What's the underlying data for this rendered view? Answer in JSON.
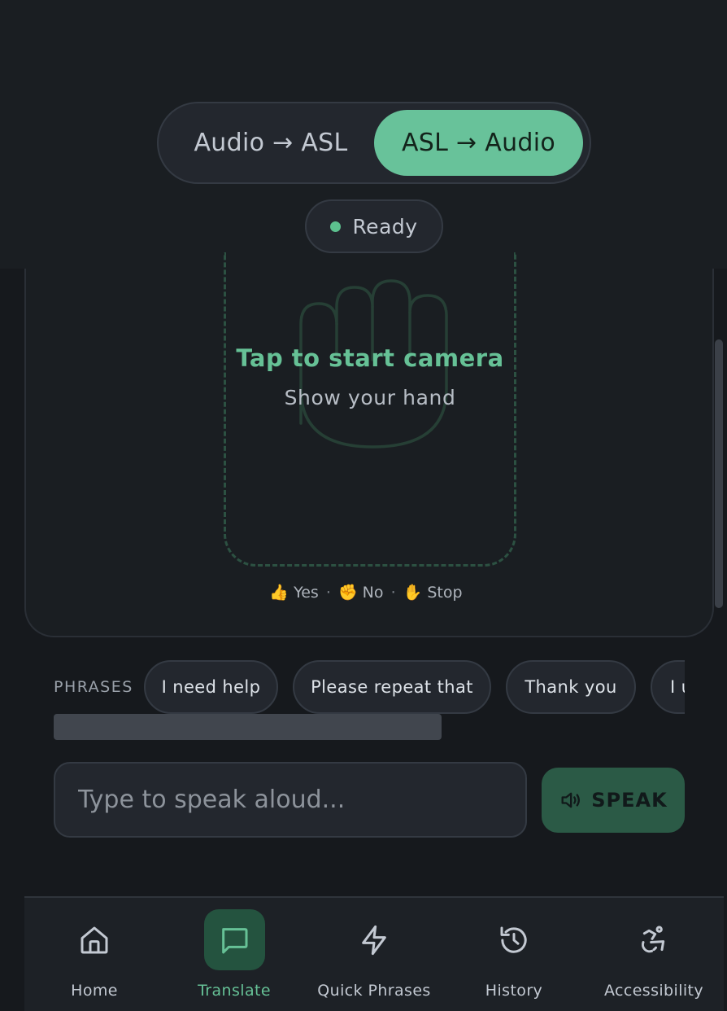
{
  "mode_toggle": {
    "options": [
      "Audio → ASL",
      "ASL → Audio"
    ],
    "selected": "ASL → Audio"
  },
  "status": {
    "label": "Ready",
    "color": "#5cc08e"
  },
  "camera": {
    "prompt": "Tap to start camera",
    "subtitle": "Show your hand",
    "icon": "hand-icon",
    "gesture_hints": [
      {
        "emoji": "👍",
        "label": "Yes"
      },
      {
        "emoji": "✊",
        "label": "No"
      },
      {
        "emoji": "✋",
        "label": "Stop"
      }
    ]
  },
  "phrases": {
    "label": "PHRASES",
    "chips": [
      "I need help",
      "Please repeat that",
      "Thank you",
      "I u"
    ]
  },
  "speak": {
    "placeholder": "Type to speak aloud...",
    "value": "",
    "button_label": "SPEAK",
    "button_icon": "speaker-icon"
  },
  "nav": {
    "active": "Translate",
    "items": [
      {
        "label": "Home",
        "icon": "home-icon"
      },
      {
        "label": "Translate",
        "icon": "chat-icon"
      },
      {
        "label": "Quick Phrases",
        "icon": "lightning-icon"
      },
      {
        "label": "History",
        "icon": "history-icon"
      },
      {
        "label": "Accessibility",
        "icon": "accessibility-icon"
      }
    ]
  },
  "colors": {
    "accent": "#68c29a",
    "background": "#16191d",
    "surface": "#23272e"
  }
}
